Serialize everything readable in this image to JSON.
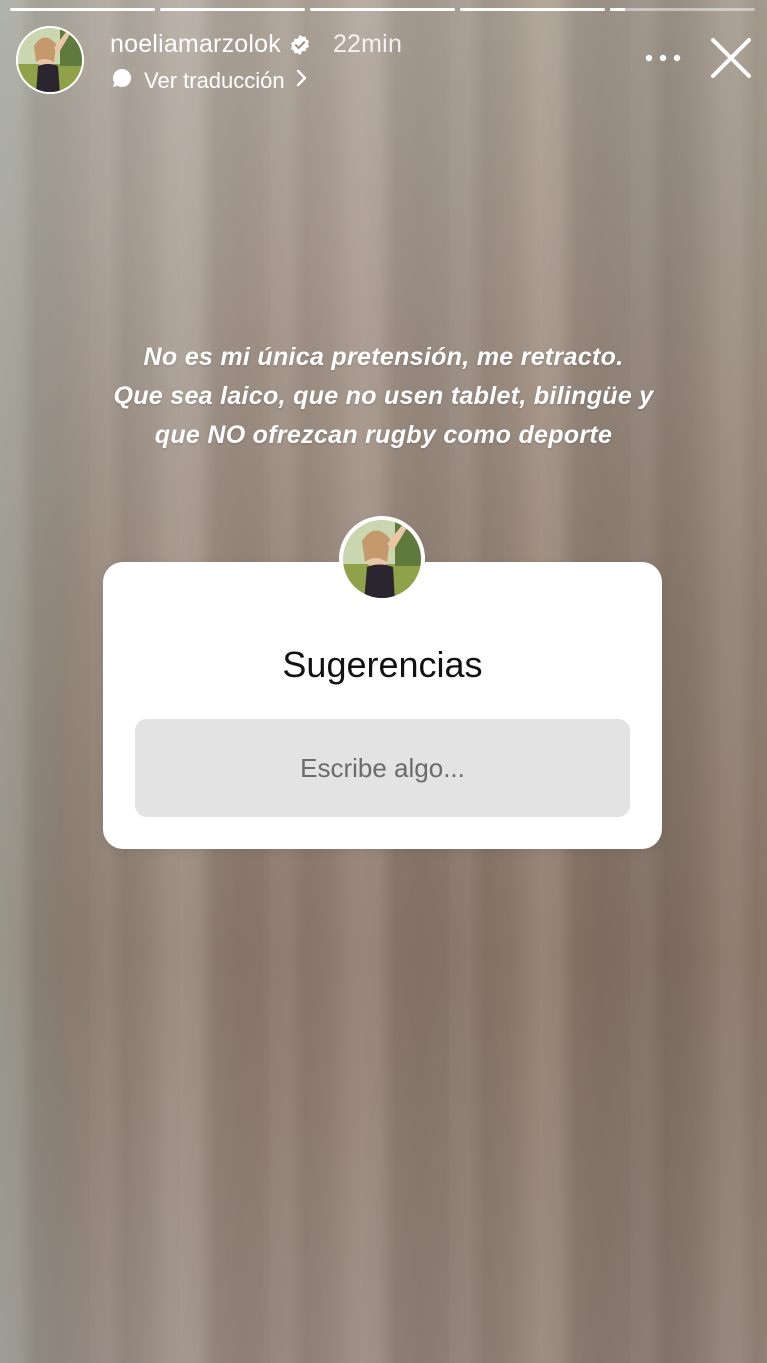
{
  "story": {
    "progress_segments": [
      {
        "fill": 1
      },
      {
        "fill": 1
      },
      {
        "fill": 1
      },
      {
        "fill": 1
      },
      {
        "fill": 0.1
      }
    ]
  },
  "header": {
    "username": "noeliamarzolok",
    "time": "22min",
    "translate_label": "Ver traducción",
    "icons": {
      "verified": "verified-badge-icon",
      "translate": "translate-bubble-icon",
      "chevron": "chevron-right-icon",
      "more": "more-options-icon",
      "close": "close-icon"
    }
  },
  "caption": {
    "lines": [
      "No es mi única pretensión, me retracto.",
      "Que sea laico, que no usen tablet, bilingüe y",
      "que NO ofrezcan rugby como deporte"
    ]
  },
  "question_sticker": {
    "title": "Sugerencias",
    "placeholder": "Escribe algo..."
  },
  "colors": {
    "verified": "#3897f0",
    "text": "#ffffff",
    "sticker_bg": "#ffffff",
    "input_bg": "#e3e3e3"
  }
}
